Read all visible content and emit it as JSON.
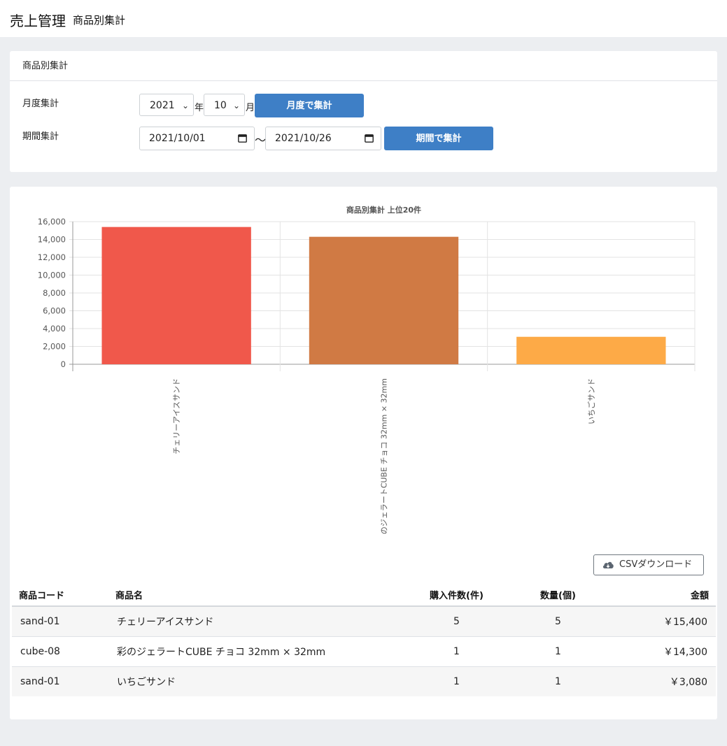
{
  "header": {
    "app_title": "売上管理",
    "page_subtitle": "商品別集計"
  },
  "filter_card": {
    "title": "商品別集計",
    "monthly": {
      "label": "月度集計",
      "year_value": "2021",
      "year_unit": "年",
      "month_value": "10",
      "month_unit": "月",
      "button": "月度で集計"
    },
    "period": {
      "label": "期間集計",
      "start_date": "2021/10/01",
      "separator": "〜",
      "end_date": "2021/10/26",
      "button": "期間で集計"
    }
  },
  "chart_data": {
    "type": "bar",
    "title": "商品別集計 上位20件",
    "categories": [
      "チェリーアイスサンド",
      "彩のジェラートCUBE チョコ 32mm × 32mm",
      "いちごサンド"
    ],
    "category_labels_shown": [
      "チェリーアイスサンド",
      "のジェラートCUBE チョコ 32mm × 32mm",
      "いちごサンド"
    ],
    "values": [
      15400,
      14300,
      3080
    ],
    "colors": [
      "#f0584b",
      "#d07a44",
      "#fdaa47"
    ],
    "ylim": [
      0,
      16000
    ],
    "yticks": [
      0,
      2000,
      4000,
      6000,
      8000,
      10000,
      12000,
      14000,
      16000
    ],
    "ytick_labels": [
      "0",
      "2,000",
      "4,000",
      "6,000",
      "8,000",
      "10,000",
      "12,000",
      "14,000",
      "16,000"
    ],
    "grid": true
  },
  "csv_button": {
    "label": "CSVダウンロード",
    "icon": "cloud-download-icon"
  },
  "table": {
    "headers": [
      "商品コード",
      "商品名",
      "購入件数(件)",
      "数量(個)",
      "金額"
    ],
    "rows": [
      [
        "sand-01",
        "チェリーアイスサンド",
        "5",
        "5",
        "￥15,400"
      ],
      [
        "cube-08",
        "彩のジェラートCUBE チョコ 32mm × 32mm",
        "1",
        "1",
        "￥14,300"
      ],
      [
        "sand-01",
        "いちごサンド",
        "1",
        "1",
        "￥3,080"
      ]
    ]
  }
}
